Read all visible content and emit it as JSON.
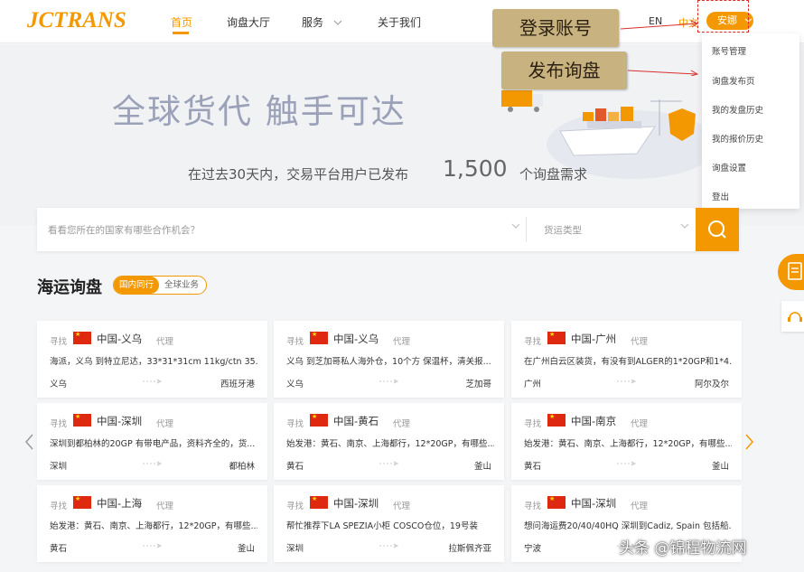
{
  "header": {
    "logo": "JCTRANS",
    "nav": [
      "首页",
      "询盘大厅",
      "服务",
      "关于我们"
    ],
    "lang_en": "EN",
    "lang_cn": "中文",
    "user": "安娜"
  },
  "callouts": {
    "login": "登录账号",
    "publish": "发布询盘"
  },
  "dropdown": [
    "账号管理",
    "询盘发布页",
    "我的发盘历史",
    "我的报价历史",
    "询盘设置",
    "登出"
  ],
  "hero": {
    "title": "全球货代 触手可达",
    "sub_prefix": "在过去30天内，交易平台用户已发布",
    "count": "1,500",
    "sub_suffix": "个询盘需求"
  },
  "search": {
    "placeholder": "看看您所在的国家有哪些合作机会？",
    "type_placeholder": "货运类型"
  },
  "section": {
    "title": "海运询盘",
    "tab_active": "国内同行",
    "tab_other": "全球业务"
  },
  "cards": [
    {
      "seek": "寻找",
      "route": "中国-义乌",
      "tag": "代理",
      "desc": "海派，义乌 到特立尼达，33*31*31cm 11kg/ctn 35...",
      "from": "义乌",
      "to": "西班牙港"
    },
    {
      "seek": "寻找",
      "route": "中国-义乌",
      "tag": "代理",
      "desc": "义乌 到芝加哥私人海外仓，10个方 保温杯，清关报...",
      "from": "义乌",
      "to": "芝加哥"
    },
    {
      "seek": "寻找",
      "route": "中国-广州",
      "tag": "代理",
      "desc": "在广州白云区装货，有没有到ALGER的1*20GP和1*4...",
      "from": "广州",
      "to": "阿尔及尔"
    },
    {
      "seek": "寻找",
      "route": "中国-深圳",
      "tag": "代理",
      "desc": "深圳到都柏林的20GP 有带电产品，资料齐全的，货...",
      "from": "深圳",
      "to": "都柏林"
    },
    {
      "seek": "寻找",
      "route": "中国-黄石",
      "tag": "代理",
      "desc": "始发港：黄石、南京、上海都行，12*20GP，有哪些...",
      "from": "黄石",
      "to": "釜山"
    },
    {
      "seek": "寻找",
      "route": "中国-南京",
      "tag": "代理",
      "desc": "始发港：黄石、南京、上海都行，12*20GP，有哪些...",
      "from": "黄石",
      "to": "釜山"
    },
    {
      "seek": "寻找",
      "route": "中国-上海",
      "tag": "代理",
      "desc": "始发港：黄石、南京、上海都行，12*20GP，有哪些...",
      "from": "黄石",
      "to": "釜山"
    },
    {
      "seek": "寻找",
      "route": "中国-深圳",
      "tag": "代理",
      "desc": "帮忙推荐下LA SPEZIA小柜 COSCO仓位，19号装",
      "from": "深圳",
      "to": "拉斯佩齐亚"
    },
    {
      "seek": "寻找",
      "route": "中国-深圳",
      "tag": "代理",
      "desc": "想问海运费20/40/40HQ 深圳到Cadiz, Spain 包括船...",
      "from": "宁波",
      "to": ""
    }
  ],
  "watermark": "头条 @锦程物流网",
  "colors": {
    "accent": "#f39800",
    "highlight": "#d9302c",
    "callout_bg": "#c8b27f"
  }
}
